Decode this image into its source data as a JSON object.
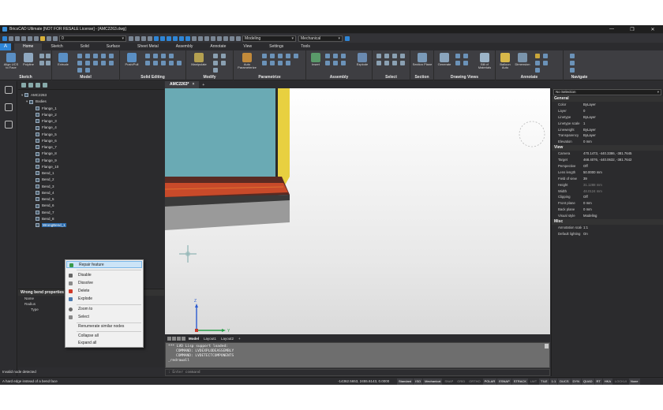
{
  "titlebar": {
    "title": "BricsCAD Ultimate [NOT FOR RESALE License] - [AMC2263.dwg]",
    "minimize": "—",
    "restore": "❐",
    "close": "✕"
  },
  "qat": {
    "layer_value": "0",
    "workspace": "Modeling",
    "profile": "Mechanical",
    "help": "?"
  },
  "app_button": "A",
  "tabs": [
    "Home",
    "Sketch",
    "Solid",
    "Surface",
    "Sheet Metal",
    "Assembly",
    "Annotate",
    "View",
    "Settings",
    "Tools"
  ],
  "ribbon": {
    "groups": [
      "Sketch",
      "Model",
      "Solid Editing",
      "Modify",
      "Parametrize",
      "Assembly",
      "Select",
      "Section",
      "Drawing Views",
      "Annotate",
      "Navigate"
    ],
    "buttons": {
      "align_ucs": "Align UCS to Face",
      "polyline": "Polyline",
      "extrude": "Extrude",
      "push_pull": "Push/Pull",
      "manipulate": "Manipulate",
      "auto_parameterize": "Auto Parameterize",
      "insert": "Insert",
      "explode": "Explode",
      "section_plane": "Section Plane",
      "generate": "Generate",
      "bill_of_materials": "Bill of Materials",
      "balloon_auto": "Balloon Auto",
      "dimension": "Dimension"
    }
  },
  "tree": {
    "root": "AMC2263",
    "bodies": "Bodies",
    "flanges": [
      "Flange_1",
      "Flange_2",
      "Flange_3",
      "Flange_4",
      "Flange_5",
      "Flange_6",
      "Flange_7",
      "Flange_8",
      "Flange_9",
      "Flange_10"
    ],
    "bends": [
      "Bend_1",
      "Bend_2",
      "Bend_3",
      "Bend_4",
      "Bend_5",
      "Bend_6",
      "Bend_7",
      "Bend_8"
    ],
    "wrong_bend": "WrongBend_1"
  },
  "context_menu": {
    "items": [
      "Repair feature",
      "Disable",
      "Dissolve",
      "Delete",
      "Explode",
      "Zoom to",
      "Select",
      "Renumerate similar nodes",
      "Collapse all",
      "Expand all"
    ]
  },
  "bend_props": {
    "title": "Wrong bend properties",
    "name": "Name",
    "radius": "Radius",
    "type": "Type"
  },
  "status_left": "Invalid node detected",
  "doc_tab": {
    "label": "AMC2263*",
    "close": "×",
    "add": "+"
  },
  "layouts": [
    "Model",
    "Layout1",
    "Layout2"
  ],
  "layout_add": "+",
  "cmdline": {
    "lines": [
      "*** LVD Lisp support loaded:",
      "COMMAND: LVDEXPLODEASSEMBLY",
      "COMMAND: LVDETECTCOMPONENTS",
      "_redrawall"
    ],
    "placeholder": ": Enter command"
  },
  "properties": {
    "selector": "No Selection",
    "groups": {
      "general": "General",
      "view": "View",
      "misc": "Misc"
    },
    "general": [
      {
        "k": "Color",
        "v": "ByLayer"
      },
      {
        "k": "Layer",
        "v": "0"
      },
      {
        "k": "Linetype",
        "v": "ByLayer"
      },
      {
        "k": "Linetype scale",
        "v": "1"
      },
      {
        "k": "Lineweight",
        "v": "ByLayer"
      },
      {
        "k": "Transparency",
        "v": "ByLayer"
      },
      {
        "k": "Elevation",
        "v": "0 mm"
      }
    ],
    "view": [
      {
        "k": "Camera",
        "v": "470.1473, -440.3386, -381.7645"
      },
      {
        "k": "Target",
        "v": "468.4076, -440.0632, -381.7642"
      },
      {
        "k": "Perspective",
        "v": "Off"
      },
      {
        "k": "Lens length",
        "v": "50.0000 mm"
      },
      {
        "k": "Field of view",
        "v": "39"
      },
      {
        "k": "Height",
        "v": "31.1288 mm"
      },
      {
        "k": "Width",
        "v": "48.0124 mm"
      },
      {
        "k": "Clipping",
        "v": "Off"
      },
      {
        "k": "Front plane",
        "v": "0 mm"
      },
      {
        "k": "Back plane",
        "v": "0 mm"
      },
      {
        "k": "Visual style",
        "v": "Modeling"
      }
    ],
    "misc": [
      {
        "k": "Annotation scale",
        "v": "1:1"
      },
      {
        "k": "Default lighting",
        "v": "On"
      }
    ]
  },
  "statusbar": {
    "message": "A hard edge instead of a bend face",
    "coords": "-14362.5653, 2455.6143, 0.0000",
    "toggles": [
      "Standard",
      "ISO",
      "Mechanical",
      "SNAP",
      "GRID",
      "ORTHO",
      "POLAR",
      "ESNAP",
      "STRACK",
      "LWT",
      "TILE",
      "1:1",
      "DUCS",
      "DYN",
      "QUAD",
      "RT",
      "HKA",
      "LOCKUI",
      "None"
    ]
  },
  "axes": {
    "x": "X",
    "y": "Y",
    "z": "Z"
  },
  "colors": {
    "accent": "#2f86d6",
    "highlight": "#cce4f7",
    "part_yellow": "#e8d040",
    "part_teal": "#6aaab4"
  }
}
